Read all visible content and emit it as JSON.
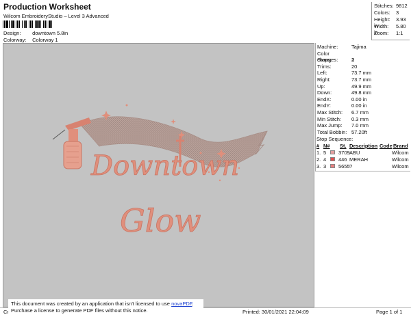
{
  "header": {
    "title": "Production Worksheet",
    "subtitle": "Wilcom EmbroideryStudio – Level 3 Advanced",
    "design_label": "Design:",
    "design_value": "downtown 5.8in",
    "colorway_label": "Colorway:",
    "colorway_value": "Colorway 1"
  },
  "stats": [
    {
      "label": "Stitches:",
      "value": "9812"
    },
    {
      "label": "Colors:",
      "value": "3"
    },
    {
      "label": "Height:",
      "value": "3.93 in"
    },
    {
      "label": "Width:",
      "value": "5.80 in"
    },
    {
      "label": "Zoom:",
      "value": "1:1"
    }
  ],
  "machine_info": [
    {
      "label": "Machine:",
      "value": "Tajima"
    },
    {
      "label": "Color changes:",
      "value": "2"
    },
    {
      "label": "Stops:",
      "value": "3"
    },
    {
      "label": "Trims:",
      "value": "20"
    },
    {
      "label": "Left:",
      "value": "73.7 mm"
    },
    {
      "label": "Right:",
      "value": "73.7 mm"
    },
    {
      "label": "Up:",
      "value": "49.9 mm"
    },
    {
      "label": "Down:",
      "value": "49.8 mm"
    },
    {
      "label": "EndX:",
      "value": "0.00 in"
    },
    {
      "label": "EndY:",
      "value": "0.00 in"
    },
    {
      "label": "Max Stitch:",
      "value": "6.7 mm"
    },
    {
      "label": "Min Stitch:",
      "value": "0.3 mm"
    },
    {
      "label": "Max Jump:",
      "value": "7.0 mm"
    },
    {
      "label": "Total Bobbin:",
      "value": "57.20ft"
    }
  ],
  "stop_sequence": {
    "title": "Stop Sequence:",
    "headers": [
      "#",
      "N#",
      "St.",
      "Description",
      "Code",
      "Brand"
    ],
    "rows": [
      {
        "num": "1.",
        "n": "5",
        "swatch": "#e3a0a0",
        "st": "3709",
        "description": "ABU",
        "code": "",
        "brand": "Wilcom"
      },
      {
        "num": "2.",
        "n": "4",
        "swatch": "#e05050",
        "st": "446",
        "description": "MERAH",
        "code": "",
        "brand": "Wilcom"
      },
      {
        "num": "3.",
        "n": "3",
        "swatch": "#e88080",
        "st": "5655",
        "description": "?",
        "code": "",
        "brand": "Wilcom"
      }
    ]
  },
  "design": {
    "word1": "Downtown",
    "word2": "Glow",
    "colors": {
      "thread": "#e08f7c",
      "banner": "#b49a92",
      "background": "#c3c3c3"
    }
  },
  "notice": {
    "line1": "This document was created by an application that isn't licensed to use",
    "link": "novaPDF",
    "line2": "Purchase a license to generate PDF files without this notice."
  },
  "footer": {
    "left": "Cr",
    "printed": "Printed: 30/01/2021 22:04:09",
    "page": "Page 1 of 1"
  }
}
